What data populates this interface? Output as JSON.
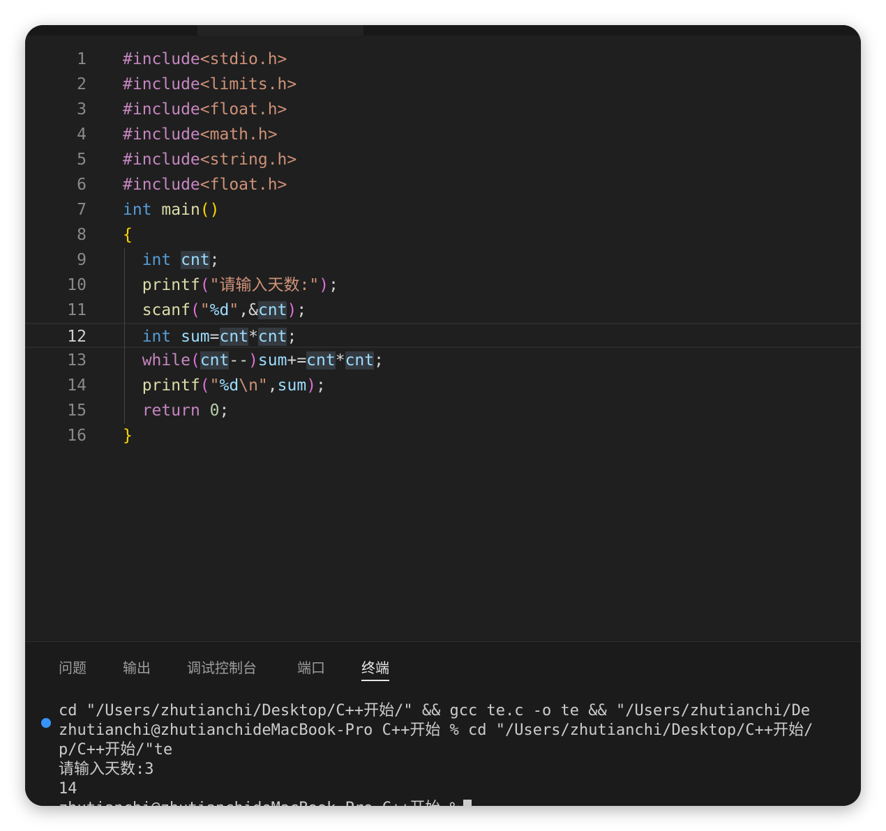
{
  "editor": {
    "lines": [
      {
        "n": "1",
        "tokens": [
          {
            "t": "#include",
            "c": "t-inc"
          },
          {
            "t": "<stdio.h>",
            "c": "t-hdr"
          }
        ]
      },
      {
        "n": "2",
        "tokens": [
          {
            "t": "#include",
            "c": "t-inc"
          },
          {
            "t": "<limits.h>",
            "c": "t-hdr"
          }
        ]
      },
      {
        "n": "3",
        "tokens": [
          {
            "t": "#include",
            "c": "t-inc"
          },
          {
            "t": "<float.h>",
            "c": "t-hdr"
          }
        ]
      },
      {
        "n": "4",
        "tokens": [
          {
            "t": "#include",
            "c": "t-inc"
          },
          {
            "t": "<math.h>",
            "c": "t-hdr"
          }
        ]
      },
      {
        "n": "5",
        "tokens": [
          {
            "t": "#include",
            "c": "t-inc"
          },
          {
            "t": "<string.h>",
            "c": "t-hdr"
          }
        ]
      },
      {
        "n": "6",
        "tokens": [
          {
            "t": "#include",
            "c": "t-inc"
          },
          {
            "t": "<float.h>",
            "c": "t-hdr"
          }
        ]
      },
      {
        "n": "7",
        "tokens": [
          {
            "t": "int",
            "c": "t-kw"
          },
          {
            "t": " "
          },
          {
            "t": "main",
            "c": "t-fn"
          },
          {
            "t": "()",
            "c": "t-b1"
          }
        ]
      },
      {
        "n": "8",
        "tokens": [
          {
            "t": "{",
            "c": "t-b1"
          }
        ]
      },
      {
        "n": "9",
        "tokens": [
          {
            "t": "  "
          },
          {
            "t": "int",
            "c": "t-kw"
          },
          {
            "t": " "
          },
          {
            "t": "cnt",
            "c": "t-var t-hl"
          },
          {
            "t": ";"
          }
        ]
      },
      {
        "n": "10",
        "tokens": [
          {
            "t": "  "
          },
          {
            "t": "printf",
            "c": "t-fn"
          },
          {
            "t": "(",
            "c": "t-b2"
          },
          {
            "t": "\"请输入天数:\"",
            "c": "t-str"
          },
          {
            "t": ")",
            "c": "t-b2"
          },
          {
            "t": ";"
          }
        ]
      },
      {
        "n": "11",
        "tokens": [
          {
            "t": "  "
          },
          {
            "t": "scanf",
            "c": "t-fn"
          },
          {
            "t": "(",
            "c": "t-b2"
          },
          {
            "t": "\"",
            "c": "t-str"
          },
          {
            "t": "%d",
            "c": "t-fmt"
          },
          {
            "t": "\"",
            "c": "t-str"
          },
          {
            "t": ",&"
          },
          {
            "t": "cnt",
            "c": "t-var t-hl"
          },
          {
            "t": ")",
            "c": "t-b2"
          },
          {
            "t": ";"
          }
        ]
      },
      {
        "n": "12",
        "tokens": [
          {
            "t": "  "
          },
          {
            "t": "int",
            "c": "t-kw"
          },
          {
            "t": " "
          },
          {
            "t": "sum",
            "c": "t-var"
          },
          {
            "t": "="
          },
          {
            "t": "cnt",
            "c": "t-var t-hl"
          },
          {
            "t": "*"
          },
          {
            "t": "cnt",
            "c": "t-var t-hl"
          },
          {
            "t": ";"
          }
        ],
        "current": true
      },
      {
        "n": "13",
        "tokens": [
          {
            "t": "  "
          },
          {
            "t": "while",
            "c": "t-ctl"
          },
          {
            "t": "(",
            "c": "t-b2"
          },
          {
            "t": "cnt",
            "c": "t-var t-hl"
          },
          {
            "t": "--"
          },
          {
            "t": ")",
            "c": "t-b2"
          },
          {
            "t": "sum",
            "c": "t-var"
          },
          {
            "t": "+="
          },
          {
            "t": "cnt",
            "c": "t-var t-hl"
          },
          {
            "t": "*"
          },
          {
            "t": "cnt",
            "c": "t-var t-hl"
          },
          {
            "t": ";"
          }
        ]
      },
      {
        "n": "14",
        "tokens": [
          {
            "t": "  "
          },
          {
            "t": "printf",
            "c": "t-fn"
          },
          {
            "t": "(",
            "c": "t-b2"
          },
          {
            "t": "\"",
            "c": "t-str"
          },
          {
            "t": "%d",
            "c": "t-fmt"
          },
          {
            "t": "\\n",
            "c": "t-hdr"
          },
          {
            "t": "\"",
            "c": "t-str"
          },
          {
            "t": ","
          },
          {
            "t": "sum",
            "c": "t-var"
          },
          {
            "t": ")",
            "c": "t-b2"
          },
          {
            "t": ";"
          }
        ]
      },
      {
        "n": "15",
        "tokens": [
          {
            "t": "  "
          },
          {
            "t": "return",
            "c": "t-ctl"
          },
          {
            "t": " "
          },
          {
            "t": "0",
            "c": "t-num"
          },
          {
            "t": ";"
          }
        ]
      },
      {
        "n": "16",
        "tokens": [
          {
            "t": "}",
            "c": "t-b1"
          }
        ]
      }
    ]
  },
  "panel": {
    "tabs": [
      {
        "label": "问题",
        "active": false
      },
      {
        "label": "输出",
        "active": false
      },
      {
        "label": "调试控制台",
        "active": false
      },
      {
        "label": "端口",
        "active": false
      },
      {
        "label": "终端",
        "active": true
      }
    ],
    "terminal": {
      "lines": [
        "cd \"/Users/zhutianchi/Desktop/C++开始/\" && gcc te.c -o te && \"/Users/zhutianchi/De",
        "zhutianchi@zhutianchideMacBook-Pro C++开始 % cd \"/Users/zhutianchi/Desktop/C++开始/",
        "p/C++开始/\"te",
        "请输入天数:3",
        "14",
        "zhutianchi@zhutianchideMacBook-Pro C++开始 %"
      ]
    }
  }
}
